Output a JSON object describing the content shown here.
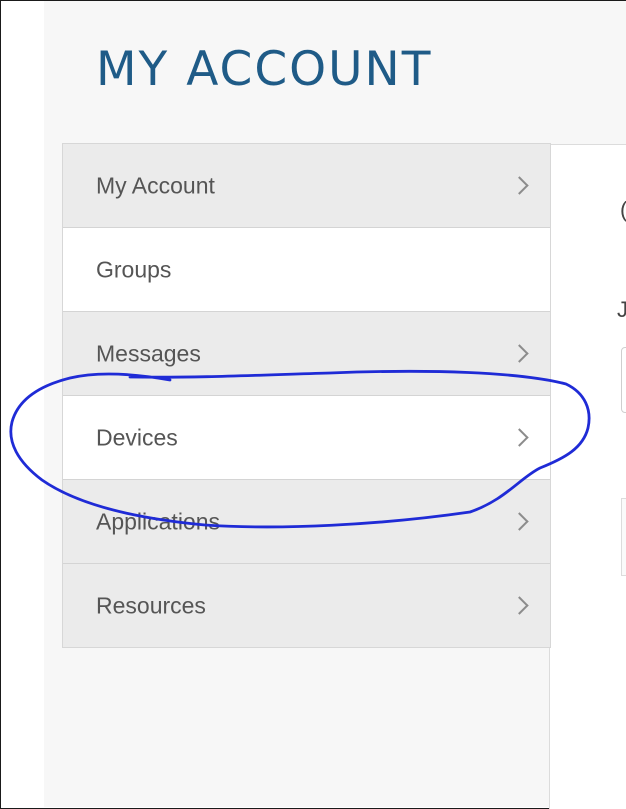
{
  "page_title": "MY ACCOUNT",
  "sidebar": {
    "items": [
      {
        "label": "My Account",
        "state": "default",
        "chevron": true
      },
      {
        "label": "Groups",
        "state": "selected",
        "chevron": false
      },
      {
        "label": "Messages",
        "state": "default",
        "chevron": true
      },
      {
        "label": "Devices",
        "state": "highlighted",
        "chevron": true
      },
      {
        "label": "Applications",
        "state": "default",
        "chevron": true
      },
      {
        "label": "Resources",
        "state": "default",
        "chevron": true
      }
    ]
  },
  "content": {
    "clipped_char_1": "(",
    "clipped_char_2": "J"
  },
  "colors": {
    "title": "#1f5b87",
    "nav_default_bg": "#ebebeb",
    "nav_active_bg": "#ffffff",
    "annotation": "#1f2bd6"
  },
  "annotation": {
    "shape": "hand-drawn ellipse",
    "target": "Devices"
  }
}
